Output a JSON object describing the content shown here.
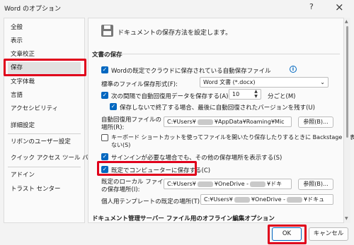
{
  "window": {
    "title": "Word のオプション",
    "help": "?",
    "close": "×"
  },
  "sidebar": {
    "items": [
      {
        "label": "全般"
      },
      {
        "label": "表示"
      },
      {
        "label": "文章校正"
      },
      {
        "label": "保存",
        "selected": true
      },
      {
        "label": "文字体裁"
      },
      {
        "label": "言語"
      },
      {
        "label": "アクセシビリティ"
      },
      {
        "label": "詳細設定"
      },
      {
        "label": "リボンのユーザー設定"
      },
      {
        "label": "クイック アクセス ツール バー"
      },
      {
        "label": "アドイン"
      },
      {
        "label": "トラスト センター"
      }
    ]
  },
  "main": {
    "header": "ドキュメントの保存方法を設定します。",
    "section_save": "文書の保存",
    "autosave_cloud": {
      "label": "Wordの既定でクラウドに保存されている自動保存ファイル",
      "checked": true
    },
    "format_label": "標準のファイル保存形式(F):",
    "format_value": "Word 文書 (*.docx)",
    "autorecover": {
      "label": "次の間隔で自動回復用データを保存する(A):",
      "checked": true,
      "minutes": "10",
      "unit": "分ごと(M)"
    },
    "keep_last": {
      "label": "保存しないで終了する場合、最後に自動回復されたバージョンを残す(U)",
      "checked": true
    },
    "autorecover_location": {
      "label_line1": "自動回復用ファイルの",
      "label_line2": "場所(R):",
      "path_prefix": "C:¥Users¥",
      "path_suffix": "¥AppData¥Roaming¥Mic",
      "browse": "参照(B)..."
    },
    "shortcut_option": {
      "label_line1": "キーボード ショートカットを使ってファイルを開いたり保存したりするときに Backstage を表示し",
      "label_line2": "ない(S)",
      "checked": false
    },
    "show_more_locations": {
      "label": "サインインが必要な場合でも、その他の保存場所を表示する(S)",
      "checked": true
    },
    "save_to_computer": {
      "label": "既定でコンピューターに保存する(C)",
      "checked": true
    },
    "local_location": {
      "label_line1": "既定のローカル ファイル",
      "label_line2": "の保存場所(I):",
      "path_prefix": "C:¥Users¥",
      "path_suffix": "¥OneDrive -",
      "path_end": "¥ドキ",
      "browse": "参照(B)..."
    },
    "template_location": {
      "label": "個人用テンプレートの既定の場所(T):",
      "path_prefix": "C:¥Users¥",
      "path_suffix": "¥OneDrive -",
      "path_end": "¥ドキュ"
    },
    "section_offline": "ドキュメント管理サーバー ファイル用のオフライン編集オプション"
  },
  "footer": {
    "ok": "OK",
    "cancel": "キャンセル"
  },
  "colors": {
    "accent": "#0067c0",
    "highlight": "#e0001b"
  }
}
